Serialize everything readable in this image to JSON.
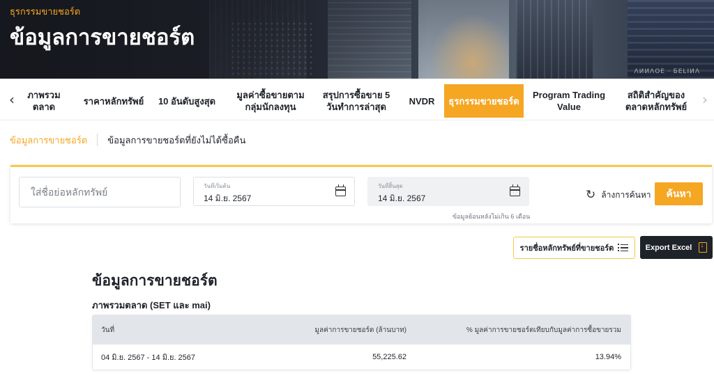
{
  "hero": {
    "breadcrumb": "ธุรกรรมขายชอร์ต",
    "title": "ข้อมูลการขายชอร์ต",
    "caption": "ΛИИΛОЕ · БΕLІИΛ"
  },
  "tabs": {
    "prev_icon": "‹",
    "next_icon": "›",
    "items": [
      {
        "label": "ภาพรวม\nตลาด"
      },
      {
        "label": "ราคาหลักทรัพย์"
      },
      {
        "label": "10 อันดับสูงสุด"
      },
      {
        "label": "มูลค่าซื้อขายตาม\nกลุ่มนักลงทุน"
      },
      {
        "label": "สรุปการซื้อขาย 5\nวันทำการล่าสุด"
      },
      {
        "label": "NVDR"
      },
      {
        "label": "ธุรกรรมขายชอร์ต"
      },
      {
        "label": "Program Trading\nValue"
      },
      {
        "label": "สถิติสำคัญของ\nตลาดหลักทรัพย์"
      }
    ],
    "active_index": 6
  },
  "subnav": {
    "active": "ข้อมูลการขายชอร์ต",
    "other": "ข้อมูลการขายชอร์ตที่ยังไม่ได้ซื้อคืน"
  },
  "filter": {
    "symbol_placeholder": "ใส่ชื่อย่อหลักทรัพย์",
    "start_label": "วันที่เริ่มต้น",
    "start_value": "14 มิ.ย. 2567",
    "end_label": "วันที่สิ้นสุด",
    "end_value": "14 มิ.ย. 2567",
    "note": "ข้อมูลย้อนหลังไม่เกิน 6 เดือน",
    "clear_label": "ล้างการค้นหา",
    "search_label": "ค้นหา"
  },
  "actions": {
    "list_label": "รายชื่อหลักทรัพย์ที่ขายชอร์ต",
    "excel_label": "Export Excel"
  },
  "section": {
    "title": "ข้อมูลการขายชอร์ต",
    "subtitle": "ภาพรวมตลาด (SET และ mai)"
  },
  "table": {
    "headers": [
      "วันที่",
      "มูลค่าการขายชอร์ต (ล้านบาท)",
      "% มูลค่าการขายชอร์ตเทียบกับมูลค่าการซื้อขายรวม"
    ],
    "rows": [
      [
        "04 มิ.ย. 2567 - 14 มิ.ย. 2567",
        "55,225.62",
        "13.94%"
      ]
    ]
  },
  "colors": {
    "accent": "#f5a623",
    "dark": "#1e2229",
    "table_header_bg": "#e2e5ea"
  }
}
